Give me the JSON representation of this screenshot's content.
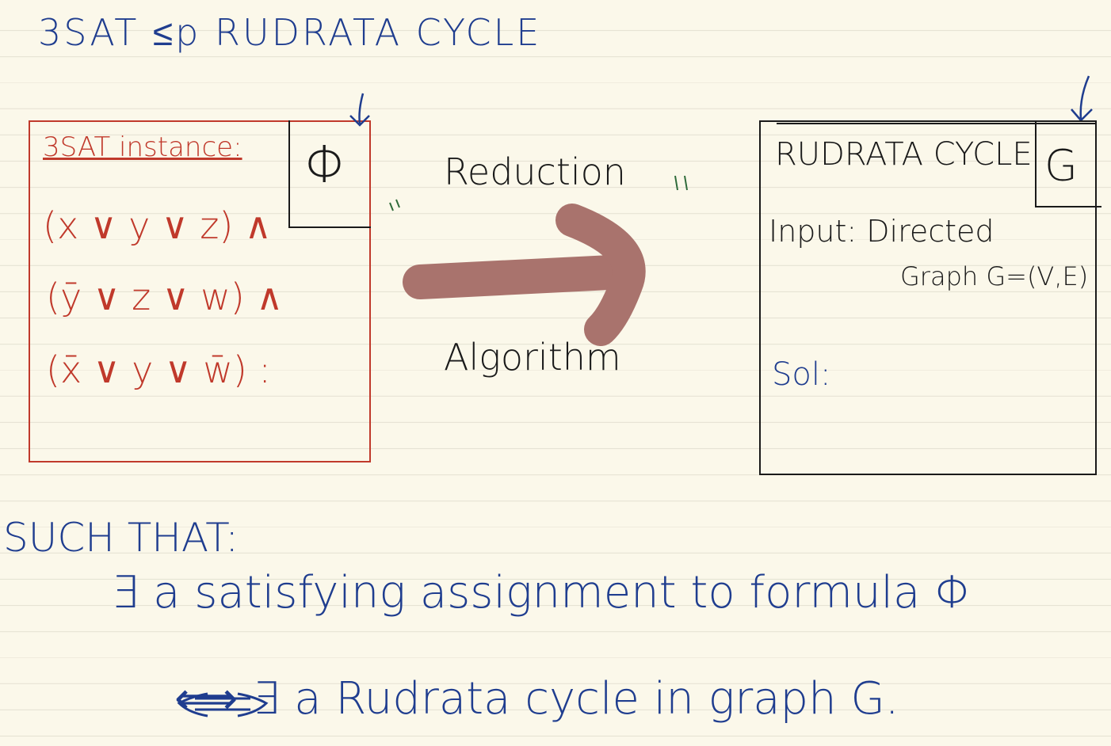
{
  "title": "3SAT ≤p RUDRATA CYCLE",
  "left_box": {
    "heading": "3SAT instance:",
    "symbol": "Φ",
    "clauses": [
      "(x ∨ y ∨ z) ∧",
      "(ȳ ∨ z ∨ w) ∧",
      "(x̄ ∨ y ∨ w̄) :"
    ]
  },
  "reduction": {
    "top_label": "Reduction",
    "bottom_label": "Algorithm"
  },
  "right_box": {
    "heading": "RUDRATA CYCLE",
    "symbol": "G",
    "input_label": "Input: Directed",
    "input_value": "Graph G=(V,E)",
    "sol_label": "Sol:"
  },
  "condition": {
    "heading": "SUCH THAT:",
    "line1": "∃ a satisfying assignment to formula Φ",
    "line2": "⟺ ∃ a Rudrata cycle in graph G."
  },
  "colors": {
    "blue_ink": "#1f3d8f",
    "red_ink": "#c0392b",
    "black_ink": "#1a1a1a",
    "green_ink": "#2f6b3a",
    "arrow": "#a9736d",
    "paper": "#fbf8ea"
  }
}
